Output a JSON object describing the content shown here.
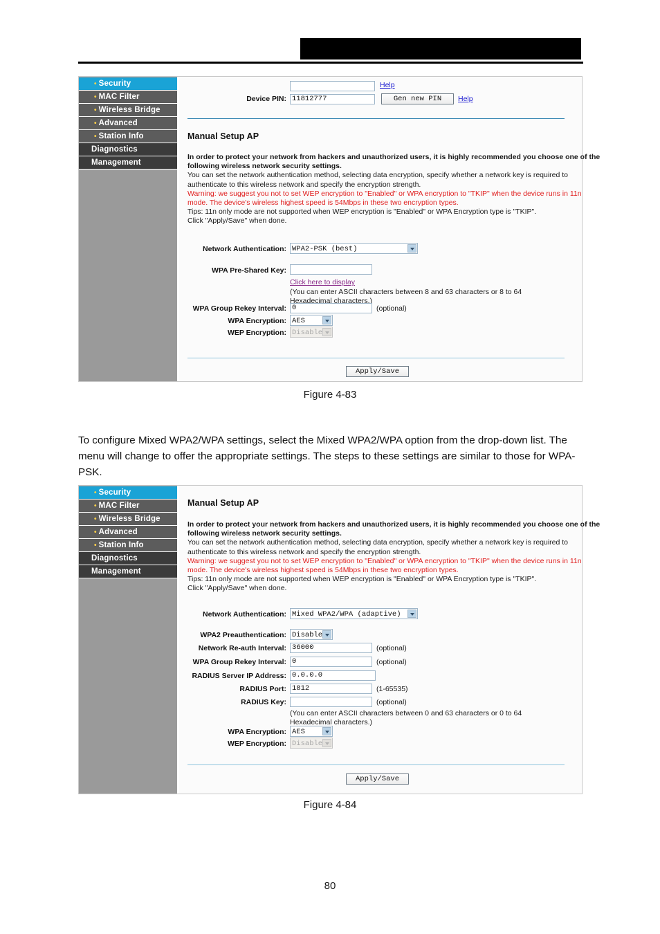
{
  "document": {
    "page_number": "80",
    "header_redacted": true
  },
  "figures": [
    {
      "caption": "Figure 4-83",
      "sidebar": [
        {
          "label": "Security",
          "type": "sub",
          "active": true
        },
        {
          "label": "MAC Filter",
          "type": "sub",
          "active": false
        },
        {
          "label": "Wireless Bridge",
          "type": "sub",
          "active": false
        },
        {
          "label": "Advanced",
          "type": "sub",
          "active": false
        },
        {
          "label": "Station Info",
          "type": "sub",
          "active": false
        },
        {
          "label": "Diagnostics",
          "type": "top",
          "active": false
        },
        {
          "label": "Management",
          "type": "top",
          "active": false
        }
      ],
      "wps": {
        "blank_field_value": "",
        "device_pin_label": "Device PIN:",
        "device_pin_value": "11812777",
        "gen_pin_button": "Gen new PIN",
        "help_link_top": "Help",
        "help_link_pin": "Help"
      },
      "section_title": "Manual Setup AP",
      "description": {
        "bold_line1": "In order to protect your network from hackers and unauthorized users, it is highly recommended you choose one of the",
        "bold_line2": "following wireless network security settings.",
        "line3": "You can set the network authentication method, selecting data encryption, specify whether a network key is required to",
        "line4": "authenticate to this wireless network and specify the encryption strength.",
        "warn1": "Warning: we suggest you not to set WEP encryption to \"Enabled\" or WPA encryption to \"TKIP\" when the device runs in 11n",
        "warn2": "mode. The device's wireless highest speed is 54Mbps in these two encryption types.",
        "line7": "Tips: 11n only mode are not supported when WEP encryption is \"Enabled\" or WPA Encryption type is \"TKIP\".",
        "line8": "Click \"Apply/Save\" when done."
      },
      "fields": {
        "network_auth_label": "Network Authentication:",
        "network_auth_value": "WPA2-PSK  (best)",
        "wpa_psk_label": "WPA Pre-Shared Key:",
        "wpa_psk_value": "",
        "click_display_link": "Click here to display",
        "psk_hint_line1": "(You can enter ASCII characters between 8 and 63 characters or 8 to 64",
        "psk_hint_line2": "Hexadecimal characters.)",
        "rekey_label": "WPA Group Rekey Interval:",
        "rekey_value": "0",
        "rekey_optional": "(optional)",
        "wpa_enc_label": "WPA Encryption:",
        "wpa_enc_value": "AES",
        "wep_enc_label": "WEP Encryption:",
        "wep_enc_value": "Disabled"
      },
      "apply_button": "Apply/Save"
    },
    {
      "caption": "Figure 4-84",
      "sidebar": [
        {
          "label": "Security",
          "type": "sub",
          "active": true
        },
        {
          "label": "MAC Filter",
          "type": "sub",
          "active": false
        },
        {
          "label": "Wireless Bridge",
          "type": "sub",
          "active": false
        },
        {
          "label": "Advanced",
          "type": "sub",
          "active": false
        },
        {
          "label": "Station Info",
          "type": "sub",
          "active": false
        },
        {
          "label": "Diagnostics",
          "type": "top",
          "active": false
        },
        {
          "label": "Management",
          "type": "top",
          "active": false
        }
      ],
      "section_title": "Manual Setup AP",
      "description": {
        "bold_line1": "In order to protect your network from hackers and unauthorized users, it is highly recommended you choose one of the",
        "bold_line2": "following wireless network security settings.",
        "line3": "You can set the network authentication method, selecting data encryption, specify whether a network key is required to",
        "line4": "authenticate to this wireless network and specify the encryption strength.",
        "warn1": "Warning: we suggest you not to set WEP encryption to \"Enabled\" or WPA encryption to \"TKIP\" when the device runs in 11n",
        "warn2": "mode. The device's wireless highest speed is 54Mbps in these two encryption types.",
        "line7": "Tips: 11n only mode are not supported when WEP encryption is \"Enabled\" or WPA Encryption type is \"TKIP\".",
        "line8": "Click \"Apply/Save\" when done."
      },
      "fields": {
        "network_auth_label": "Network Authentication:",
        "network_auth_value": "Mixed WPA2/WPA (adaptive)",
        "preauth_label": "WPA2 Preauthentication:",
        "preauth_value": "Disabled",
        "reauth_label": "Network Re-auth Interval:",
        "reauth_value": "36000",
        "reauth_optional": "(optional)",
        "rekey_label": "WPA Group Rekey Interval:",
        "rekey_value": "0",
        "rekey_optional": "(optional)",
        "radius_ip_label": "RADIUS Server IP Address:",
        "radius_ip_value": "0.0.0.0",
        "radius_port_label": "RADIUS Port:",
        "radius_port_value": "1812",
        "radius_port_range": "(1-65535)",
        "radius_key_label": "RADIUS Key:",
        "radius_key_value": "",
        "radius_key_optional": "(optional)",
        "key_hint_line1": "(You can enter ASCII characters between 0 and 63 characters or 0 to 64",
        "key_hint_line2": "Hexadecimal characters.)",
        "wpa_enc_label": "WPA Encryption:",
        "wpa_enc_value": "AES",
        "wep_enc_label": "WEP Encryption:",
        "wep_enc_value": "Disabled"
      },
      "apply_button": "Apply/Save"
    }
  ],
  "body_text": {
    "paragraph_line1": "To configure Mixed WPA2/WPA settings, select the Mixed WPA2/WPA option from the drop-down",
    "paragraph_line2": "list. The menu will change to offer the appropriate settings. The steps to these settings are similar",
    "paragraph_line3": "to those for WPA-PSK."
  },
  "colors": {
    "sidebar_bg": "#9a9a9a",
    "menu_item": "#555555",
    "menu_active": "#1aa3d6",
    "menu_top": "#3b3b3b",
    "rule_blue": "#2a7fae",
    "warning_red": "#e01f1f",
    "link_blue": "#1a1ad0",
    "link_visited": "#8b2f8b"
  }
}
